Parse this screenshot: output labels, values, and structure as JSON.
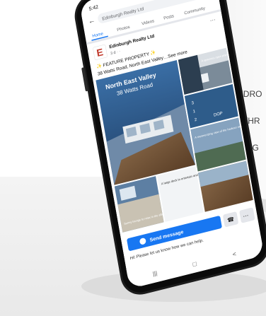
{
  "brochure": {
    "features": [
      {
        "number": "3",
        "label": "BEDRO"
      },
      {
        "number": "1",
        "label": "BATHR"
      },
      {
        "number": "2",
        "label": "CAR G"
      }
    ],
    "number_color": "#3a8f2a"
  },
  "phone": {
    "status_time": "5:42",
    "search_text": "Edinburgh Realty Ltd",
    "tabs": [
      "Home",
      "Photos",
      "Videos",
      "Posts",
      "Community"
    ],
    "active_tab_color": "#1877f2",
    "page_name": "Edinburgh Realty Ltd",
    "page_meta": "3 d · ·",
    "logo_letter": "E",
    "post_text": "✨ FEATURE PROPERTY ✨",
    "post_text_2": "38 Watts Road, North East Valley…See more",
    "photo_title_1": "North East Valley",
    "photo_title_2": "38 Watts Road",
    "caption_kitchen": "A spacious open plan kitchen with modern appliances",
    "specs": [
      "3",
      "1",
      "2",
      "DOP"
    ],
    "caption_deck": "A large deck to entertain and soak up the sun and views",
    "caption_views": "A mesmerizing view of the harbour welcomes a new home",
    "caption_lounge": "Sunny lounge to relax in the afternoon",
    "send_message_label": "Send message",
    "chat_prompt": "Hi! Please let us know how we can help.",
    "nav_buttons": [
      "|||",
      "□",
      "<"
    ]
  }
}
